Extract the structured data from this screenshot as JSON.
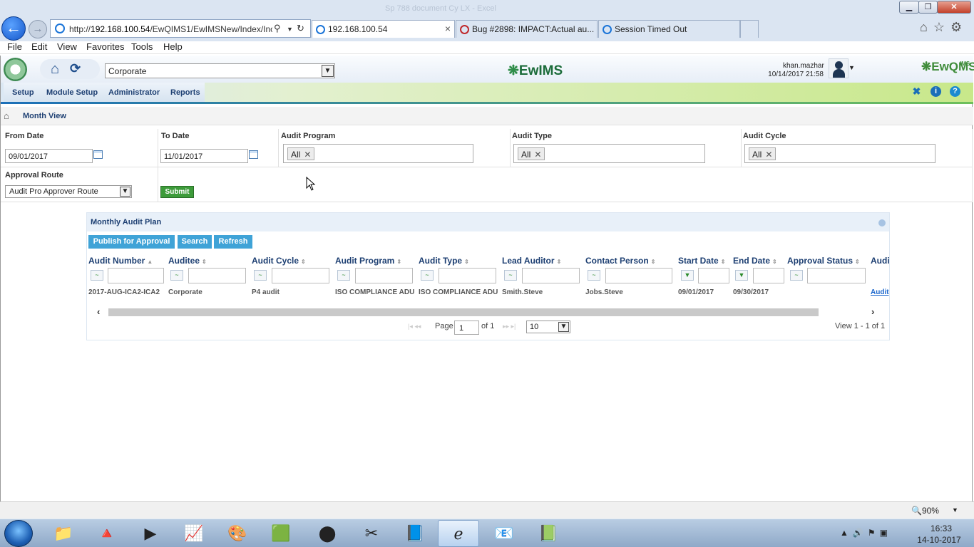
{
  "browser": {
    "window_title": "Sp 788 document Cy LX - Excel",
    "address_host": "192.168.100.54",
    "address_prefix": "http://",
    "address_path": "/EwQIMS1/EwIMSNew/Index/Inc",
    "tabs": [
      {
        "label": "192.168.100.54",
        "active": true
      },
      {
        "label": "Bug #2898: IMPACT:Actual au...",
        "active": false
      },
      {
        "label": "Session Timed Out",
        "active": false
      }
    ],
    "menu": [
      "File",
      "Edit",
      "View",
      "Favorites",
      "Tools",
      "Help"
    ]
  },
  "app": {
    "org_select_value": "Corporate",
    "logo_text": "EwIMS",
    "right_logo": "EwQMS",
    "right_logo_badge": "IMS",
    "user": {
      "name": "khan.mazhar",
      "datetime": "10/14/2017 21:58"
    },
    "menu": [
      "Setup",
      "Module Setup",
      "Administrator",
      "Reports"
    ],
    "breadcrumb": "Month View"
  },
  "filters": {
    "from_date": {
      "label": "From Date",
      "value": "09/01/2017"
    },
    "to_date": {
      "label": "To Date",
      "value": "11/01/2017"
    },
    "audit_program": {
      "label": "Audit Program",
      "chip": "All"
    },
    "audit_type": {
      "label": "Audit Type",
      "chip": "All"
    },
    "audit_cycle": {
      "label": "Audit Cycle",
      "chip": "All"
    },
    "approval_route": {
      "label": "Approval Route",
      "value": "Audit Pro Approver Route"
    },
    "submit_label": "Submit"
  },
  "grid": {
    "title": "Monthly Audit Plan",
    "toolbar": [
      "Publish for Approval",
      "Search",
      "Refresh"
    ],
    "columns": [
      "Audit Number",
      "Auditee",
      "Audit Cycle",
      "Audit Program",
      "Audit Type",
      "Lead Auditor",
      "Contact Person",
      "Start Date",
      "End Date",
      "Approval Status",
      "Audi"
    ],
    "rows": [
      [
        "2017-AUG-ICA2-ICA2",
        "Corporate",
        "P4 audit",
        "ISO COMPLIANCE ADU",
        "ISO COMPLIANCE ADU",
        "Smith.Steve",
        "Jobs.Steve",
        "09/01/2017",
        "09/30/2017",
        "",
        "Audit"
      ]
    ],
    "pager": {
      "page_label": "Page",
      "page": "1",
      "of_label": "of 1",
      "rows_per_page": "10",
      "view_text": "View 1 - 1 of 1"
    }
  },
  "status": {
    "zoom": "90%"
  },
  "taskbar": {
    "time": "16:33",
    "date": "14-10-2017"
  },
  "colors": {
    "accent": "#1d3f72",
    "button": "#3fa3d7",
    "submit": "#3d9b3a",
    "link": "#1a66cc"
  }
}
